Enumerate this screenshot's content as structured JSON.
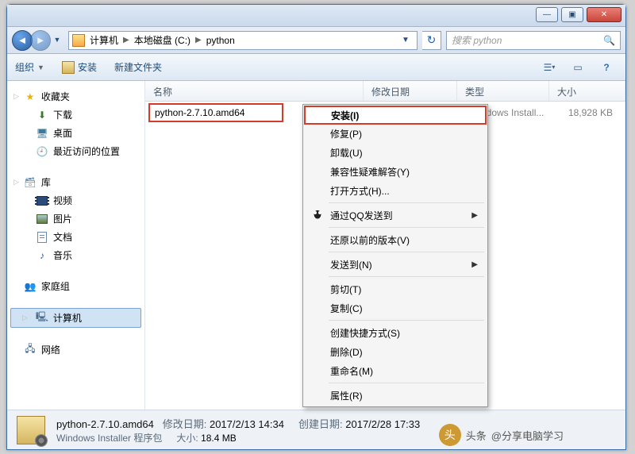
{
  "titlebar": {
    "min": "—",
    "max": "▣",
    "close": "✕"
  },
  "address": {
    "crumbs": [
      "计算机",
      "本地磁盘 (C:)",
      "python"
    ]
  },
  "search": {
    "placeholder": "搜索 python",
    "icon": "🔍"
  },
  "toolbar": {
    "organize": "组织",
    "install": "安装",
    "newfolder": "新建文件夹"
  },
  "sidebar": {
    "favorites": {
      "label": "收藏夹",
      "items": [
        "下载",
        "桌面",
        "最近访问的位置"
      ]
    },
    "libraries": {
      "label": "库",
      "items": [
        "视频",
        "图片",
        "文档",
        "音乐"
      ]
    },
    "homegroup": {
      "label": "家庭组"
    },
    "computer": {
      "label": "计算机"
    },
    "network": {
      "label": "网络"
    }
  },
  "columns": {
    "name": "名称",
    "modified": "修改日期",
    "type": "类型",
    "size": "大小"
  },
  "file": {
    "name": "python-2.7.10.amd64",
    "modified": "2017/2/13 14:34",
    "type": "Windows Install...",
    "size": "18,928 KB"
  },
  "contextmenu": {
    "install": "安装(I)",
    "repair": "修复(P)",
    "uninstall": "卸载(U)",
    "compat": "兼容性疑难解答(Y)",
    "openwith": "打开方式(H)...",
    "qqsend": "通过QQ发送到",
    "restore": "还原以前的版本(V)",
    "sendto": "发送到(N)",
    "cut": "剪切(T)",
    "copy": "复制(C)",
    "shortcut": "创建快捷方式(S)",
    "delete": "删除(D)",
    "rename": "重命名(M)",
    "properties": "属性(R)"
  },
  "statusbar": {
    "filename": "python-2.7.10.amd64",
    "filetype": "Windows Installer 程序包",
    "modified_label": "修改日期:",
    "modified_value": "2017/2/13 14:34",
    "size_label": "大小:",
    "size_value": "18.4 MB",
    "created_label": "创建日期:",
    "created_value": "2017/2/28 17:33"
  },
  "watermark": {
    "prefix": "头条",
    "handle": "@分享电脑学习"
  }
}
